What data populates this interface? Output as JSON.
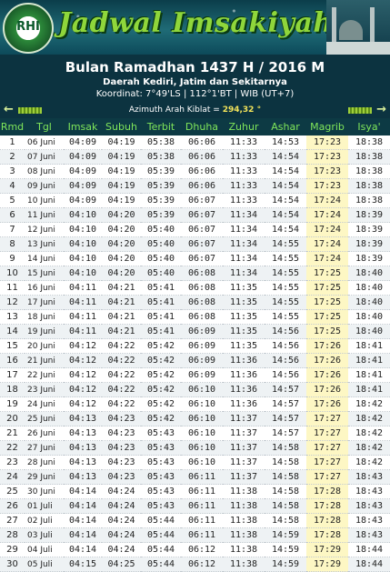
{
  "header": {
    "logo_text": "RHI",
    "brand_title": "Jadwal Imsakiyah",
    "title": "Bulan Ramadhan 1437 H / 2016 M",
    "region": "Daerah Kediri, Jatim dan Sekitarnya",
    "coords": "Koordinat: 7°49'LS | 112°1'BT | WIB (UT+7)",
    "azimuth_label": "Azimuth Arah Kiblat =",
    "azimuth_value": "294,32 °",
    "arrow_left": "←",
    "arrow_right": "→"
  },
  "table": {
    "columns": [
      "Rmd",
      "Tgl",
      "Imsak",
      "Subuh",
      "Terbit",
      "Dhuha",
      "Zuhur",
      "Ashar",
      "Magrib",
      "Isya'"
    ],
    "rows": [
      [
        "1",
        "06 Juni",
        "04:09",
        "04:19",
        "05:38",
        "06:06",
        "11:33",
        "14:53",
        "17:23",
        "18:38"
      ],
      [
        "2",
        "07 Juni",
        "04:09",
        "04:19",
        "05:38",
        "06:06",
        "11:33",
        "14:54",
        "17:23",
        "18:38"
      ],
      [
        "3",
        "08 Juni",
        "04:09",
        "04:19",
        "05:39",
        "06:06",
        "11:33",
        "14:54",
        "17:23",
        "18:38"
      ],
      [
        "4",
        "09 Juni",
        "04:09",
        "04:19",
        "05:39",
        "06:06",
        "11:33",
        "14:54",
        "17:23",
        "18:38"
      ],
      [
        "5",
        "10 Juni",
        "04:09",
        "04:19",
        "05:39",
        "06:07",
        "11:33",
        "14:54",
        "17:24",
        "18:38"
      ],
      [
        "6",
        "11 Juni",
        "04:10",
        "04:20",
        "05:39",
        "06:07",
        "11:34",
        "14:54",
        "17:24",
        "18:39"
      ],
      [
        "7",
        "12 Juni",
        "04:10",
        "04:20",
        "05:40",
        "06:07",
        "11:34",
        "14:54",
        "17:24",
        "18:39"
      ],
      [
        "8",
        "13 Juni",
        "04:10",
        "04:20",
        "05:40",
        "06:07",
        "11:34",
        "14:55",
        "17:24",
        "18:39"
      ],
      [
        "9",
        "14 Juni",
        "04:10",
        "04:20",
        "05:40",
        "06:07",
        "11:34",
        "14:55",
        "17:24",
        "18:39"
      ],
      [
        "10",
        "15 Juni",
        "04:10",
        "04:20",
        "05:40",
        "06:08",
        "11:34",
        "14:55",
        "17:25",
        "18:40"
      ],
      [
        "11",
        "16 Juni",
        "04:11",
        "04:21",
        "05:41",
        "06:08",
        "11:35",
        "14:55",
        "17:25",
        "18:40"
      ],
      [
        "12",
        "17 Juni",
        "04:11",
        "04:21",
        "05:41",
        "06:08",
        "11:35",
        "14:55",
        "17:25",
        "18:40"
      ],
      [
        "13",
        "18 Juni",
        "04:11",
        "04:21",
        "05:41",
        "06:08",
        "11:35",
        "14:55",
        "17:25",
        "18:40"
      ],
      [
        "14",
        "19 Juni",
        "04:11",
        "04:21",
        "05:41",
        "06:09",
        "11:35",
        "14:56",
        "17:25",
        "18:40"
      ],
      [
        "15",
        "20 Juni",
        "04:12",
        "04:22",
        "05:42",
        "06:09",
        "11:35",
        "14:56",
        "17:26",
        "18:41"
      ],
      [
        "16",
        "21 Juni",
        "04:12",
        "04:22",
        "05:42",
        "06:09",
        "11:36",
        "14:56",
        "17:26",
        "18:41"
      ],
      [
        "17",
        "22 Juni",
        "04:12",
        "04:22",
        "05:42",
        "06:09",
        "11:36",
        "14:56",
        "17:26",
        "18:41"
      ],
      [
        "18",
        "23 Juni",
        "04:12",
        "04:22",
        "05:42",
        "06:10",
        "11:36",
        "14:57",
        "17:26",
        "18:41"
      ],
      [
        "19",
        "24 Juni",
        "04:12",
        "04:22",
        "05:42",
        "06:10",
        "11:36",
        "14:57",
        "17:26",
        "18:42"
      ],
      [
        "20",
        "25 Juni",
        "04:13",
        "04:23",
        "05:42",
        "06:10",
        "11:37",
        "14:57",
        "17:27",
        "18:42"
      ],
      [
        "21",
        "26 Juni",
        "04:13",
        "04:23",
        "05:43",
        "06:10",
        "11:37",
        "14:57",
        "17:27",
        "18:42"
      ],
      [
        "22",
        "27 Juni",
        "04:13",
        "04:23",
        "05:43",
        "06:10",
        "11:37",
        "14:58",
        "17:27",
        "18:42"
      ],
      [
        "23",
        "28 Juni",
        "04:13",
        "04:23",
        "05:43",
        "06:10",
        "11:37",
        "14:58",
        "17:27",
        "18:42"
      ],
      [
        "24",
        "29 Juni",
        "04:13",
        "04:23",
        "05:43",
        "06:11",
        "11:37",
        "14:58",
        "17:27",
        "18:43"
      ],
      [
        "25",
        "30 Juni",
        "04:14",
        "04:24",
        "05:43",
        "06:11",
        "11:38",
        "14:58",
        "17:28",
        "18:43"
      ],
      [
        "26",
        "01 Juli",
        "04:14",
        "04:24",
        "05:43",
        "06:11",
        "11:38",
        "14:58",
        "17:28",
        "18:43"
      ],
      [
        "27",
        "02 Juli",
        "04:14",
        "04:24",
        "05:44",
        "06:11",
        "11:38",
        "14:58",
        "17:28",
        "18:43"
      ],
      [
        "28",
        "03 Juli",
        "04:14",
        "04:24",
        "05:44",
        "06:11",
        "11:38",
        "14:59",
        "17:28",
        "18:43"
      ],
      [
        "29",
        "04 Juli",
        "04:14",
        "04:24",
        "05:44",
        "06:12",
        "11:38",
        "14:59",
        "17:29",
        "18:44"
      ],
      [
        "30",
        "05 Juli",
        "04:15",
        "04:25",
        "05:44",
        "06:12",
        "11:38",
        "14:59",
        "17:29",
        "18:44"
      ]
    ]
  },
  "colors": {
    "header_bg": "#0c3340",
    "column_header_text": "#7fe65a",
    "brand_green": "#8fd63b",
    "azimuth_value": "#f2e35a",
    "highlight_column": "#fdf7c4"
  }
}
